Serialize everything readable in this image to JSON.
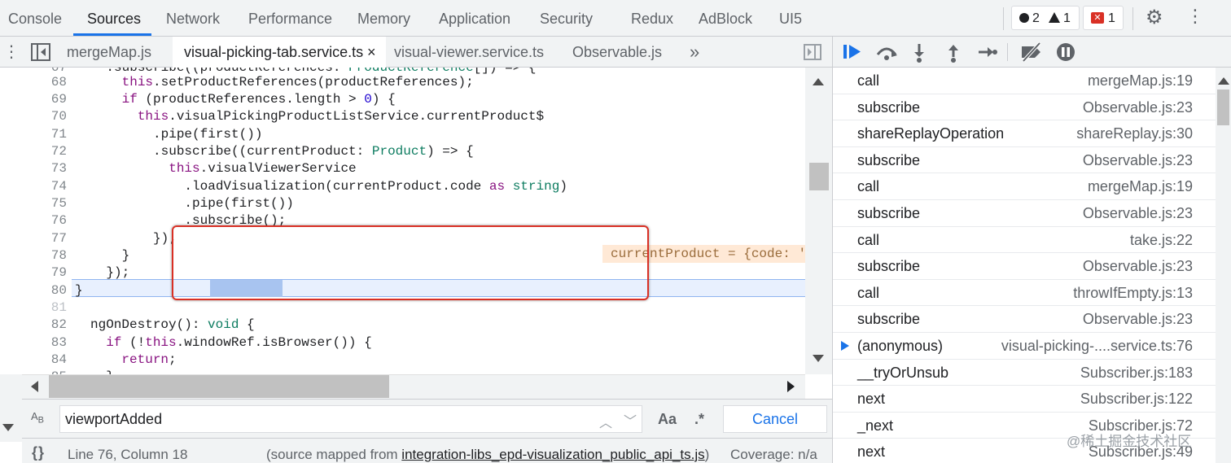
{
  "panel_tabs": [
    "Console",
    "Sources",
    "Network",
    "Performance",
    "Memory",
    "Application",
    "Security",
    "Redux",
    "AdBlock",
    "UI5"
  ],
  "active_panel_tab": "Sources",
  "counters": {
    "issues_count": "2",
    "warnings_count": "1",
    "errors_count": "1"
  },
  "file_tabs": {
    "items": [
      "mergeMap.js",
      "visual-picking-tab.service.ts",
      "visual-viewer.service.ts",
      "Observable.js"
    ],
    "active": "visual-picking-tab.service.ts",
    "close_glyph": "×",
    "more_glyph": "»"
  },
  "code": {
    "lines": [
      {
        "num": "67",
        "text": "    .subscribe((productReferences: ProductReference[]) => {"
      },
      {
        "num": "68",
        "text": "      this.setProductReferences(productReferences);"
      },
      {
        "num": "69",
        "text": "      if (productReferences.length > 0) {"
      },
      {
        "num": "70",
        "text": "        this.visualPickingProductListService.currentProduct$"
      },
      {
        "num": "71",
        "text": "          .pipe(first())"
      },
      {
        "num": "72",
        "text": "          .subscribe((currentProduct: Product) => {"
      },
      {
        "num": "73",
        "text": "            this.visualViewerService"
      },
      {
        "num": "74",
        "text": "              .loadVisualization(currentProduct.code as string)"
      },
      {
        "num": "75",
        "text": "              .pipe(first())"
      },
      {
        "num": "76",
        "text": "              .subscribe();"
      },
      {
        "num": "77",
        "text": "          });"
      },
      {
        "num": "78",
        "text": "      }"
      },
      {
        "num": "79",
        "text": "    });"
      },
      {
        "num": "80",
        "text": "}"
      },
      {
        "num": "81",
        "text": ""
      },
      {
        "num": "82",
        "text": "ngOnDestroy(): void {"
      },
      {
        "num": "83",
        "text": "  if (!this.windowRef.isBrowser()) {"
      },
      {
        "num": "84",
        "text": "    return;"
      },
      {
        "num": "85",
        "text": "  }"
      }
    ],
    "inline_value": "currentProduct = {code: '",
    "highlighted_token": "subscribe"
  },
  "search": {
    "value": "viewportAdded",
    "case_label": "Aa",
    "regex_label": ".*",
    "cancel_label": "Cancel"
  },
  "status": {
    "position": "Line 76, Column 18",
    "source_prefix": "(source mapped from ",
    "source_link": "integration-libs_epd-visualization_public_api_ts.js",
    "source_suffix": ")",
    "coverage": "Coverage: n/a",
    "braces_label": "{}"
  },
  "call_stack": [
    {
      "fn": "call",
      "loc": "mergeMap.js:19"
    },
    {
      "fn": "subscribe",
      "loc": "Observable.js:23"
    },
    {
      "fn": "shareReplayOperation",
      "loc": "shareReplay.js:30"
    },
    {
      "fn": "subscribe",
      "loc": "Observable.js:23"
    },
    {
      "fn": "call",
      "loc": "mergeMap.js:19"
    },
    {
      "fn": "subscribe",
      "loc": "Observable.js:23"
    },
    {
      "fn": "call",
      "loc": "take.js:22"
    },
    {
      "fn": "subscribe",
      "loc": "Observable.js:23"
    },
    {
      "fn": "call",
      "loc": "throwIfEmpty.js:13"
    },
    {
      "fn": "subscribe",
      "loc": "Observable.js:23"
    },
    {
      "fn": "(anonymous)",
      "loc": "visual-picking-....service.ts:76",
      "current": true
    },
    {
      "fn": "__tryOrUnsub",
      "loc": "Subscriber.js:183"
    },
    {
      "fn": "next",
      "loc": "Subscriber.js:122"
    },
    {
      "fn": "_next",
      "loc": "Subscriber.js:72"
    },
    {
      "fn": "next",
      "loc": "Subscriber.js:49"
    }
  ],
  "watermark": "@稀土掘金技术社区",
  "colors": {
    "accent": "#1a73e8",
    "error": "#d93025",
    "highlight_box": "#d93025"
  }
}
